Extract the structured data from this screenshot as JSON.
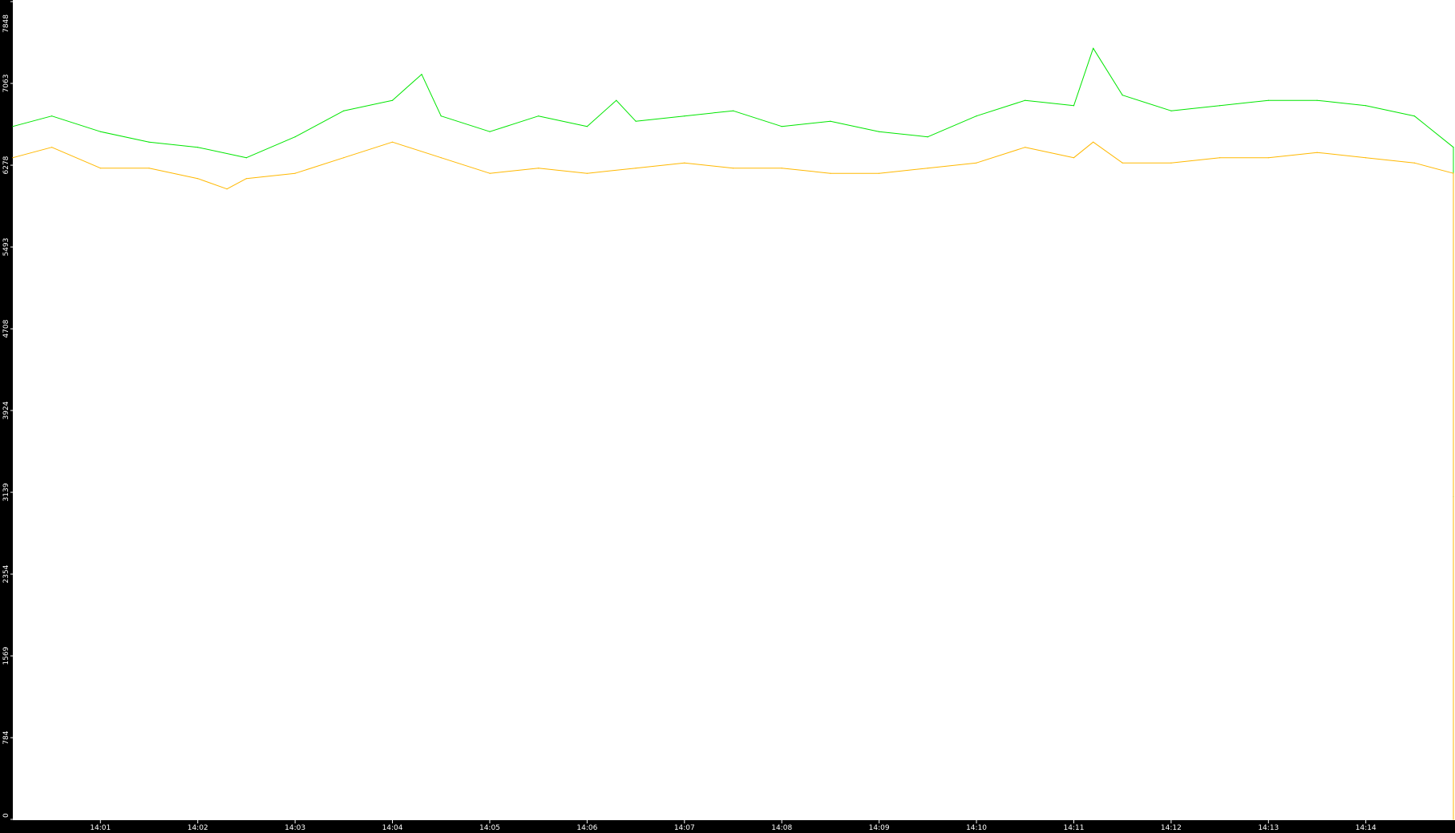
{
  "chart_data": {
    "type": "line",
    "ylim": [
      0,
      7848
    ],
    "yticks": [
      0,
      784,
      1569,
      2354,
      3139,
      3924,
      4708,
      5493,
      6278,
      7063,
      7848
    ],
    "ytick_labels": [
      "0",
      "784",
      "1569",
      "2354",
      "3139",
      "3924",
      "4708",
      "5493",
      "6278",
      "7063",
      "7848"
    ],
    "xlim_minutes": [
      0.1,
      14.9
    ],
    "xticks_minutes": [
      1,
      2,
      3,
      4,
      5,
      6,
      7,
      8,
      9,
      10,
      11,
      12,
      13,
      14
    ],
    "xtick_labels": [
      "14:01",
      "14:02",
      "14:03",
      "14:04",
      "14:05",
      "14:06",
      "14:07",
      "14:08",
      "14:09",
      "14:10",
      "14:11",
      "14:12",
      "14:13",
      "14:14"
    ],
    "grid": false,
    "legend": "none",
    "axis_color": "#000000",
    "background_color": "#ffffff",
    "series": [
      {
        "color": "#00e600",
        "x_minutes": [
          0.1,
          0.5,
          1.0,
          1.5,
          2.0,
          2.5,
          3.0,
          3.5,
          4.0,
          4.3,
          4.5,
          5.0,
          5.5,
          6.0,
          6.3,
          6.5,
          7.0,
          7.5,
          8.0,
          8.5,
          9.0,
          9.5,
          10.0,
          10.5,
          11.0,
          11.2,
          11.5,
          12.0,
          12.5,
          13.0,
          13.5,
          14.0,
          14.5,
          14.9,
          14.9
        ],
        "values": [
          6650,
          6750,
          6600,
          6500,
          6450,
          6350,
          6550,
          6800,
          6900,
          7150,
          6750,
          6600,
          6750,
          6650,
          6900,
          6700,
          6750,
          6800,
          6650,
          6700,
          6600,
          6550,
          6750,
          6900,
          6850,
          7400,
          6950,
          6800,
          6850,
          6900,
          6900,
          6850,
          6750,
          6450,
          3100
        ]
      },
      {
        "color": "#ffb800",
        "x_minutes": [
          0.1,
          0.5,
          1.0,
          1.5,
          2.0,
          2.3,
          2.5,
          3.0,
          3.5,
          4.0,
          4.5,
          5.0,
          5.5,
          6.0,
          6.5,
          7.0,
          7.5,
          8.0,
          8.5,
          9.0,
          9.5,
          10.0,
          10.5,
          11.0,
          11.2,
          11.5,
          12.0,
          12.5,
          13.0,
          13.5,
          14.0,
          14.5,
          14.9,
          14.9
        ],
        "values": [
          6350,
          6450,
          6250,
          6250,
          6150,
          6050,
          6150,
          6200,
          6350,
          6500,
          6350,
          6200,
          6250,
          6200,
          6250,
          6300,
          6250,
          6250,
          6200,
          6200,
          6250,
          6300,
          6450,
          6350,
          6500,
          6300,
          6300,
          6350,
          6350,
          6400,
          6350,
          6300,
          6200,
          0
        ]
      }
    ]
  }
}
